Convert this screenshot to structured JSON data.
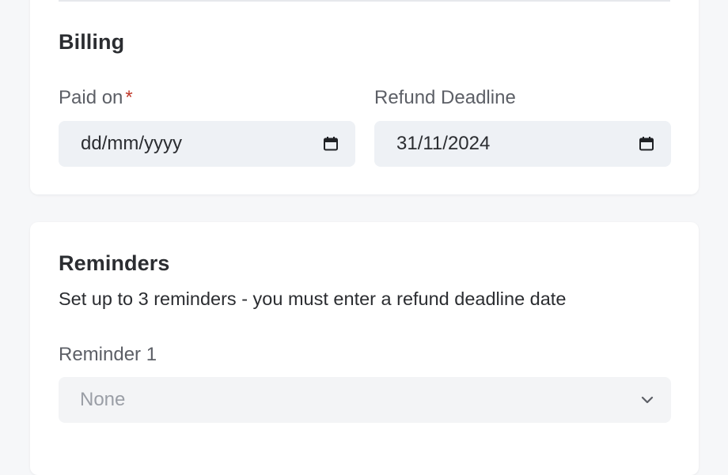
{
  "billing": {
    "title": "Billing",
    "paid_on": {
      "label": "Paid on",
      "required_mark": "*",
      "value": "dd/mm/yyyy"
    },
    "refund_deadline": {
      "label": "Refund Deadline",
      "value": "31/11/2024"
    },
    "icon": "calendar-icon"
  },
  "reminders": {
    "title": "Reminders",
    "description": "Set up to 3 reminders - you must enter a refund deadline date",
    "reminder_1": {
      "label": "Reminder 1",
      "selected": "None",
      "icon": "chevron-down-icon"
    }
  },
  "colors": {
    "background": "#f6f7f9",
    "card": "#ffffff",
    "input_bg": "#eef1f5",
    "required": "#c0392b"
  }
}
